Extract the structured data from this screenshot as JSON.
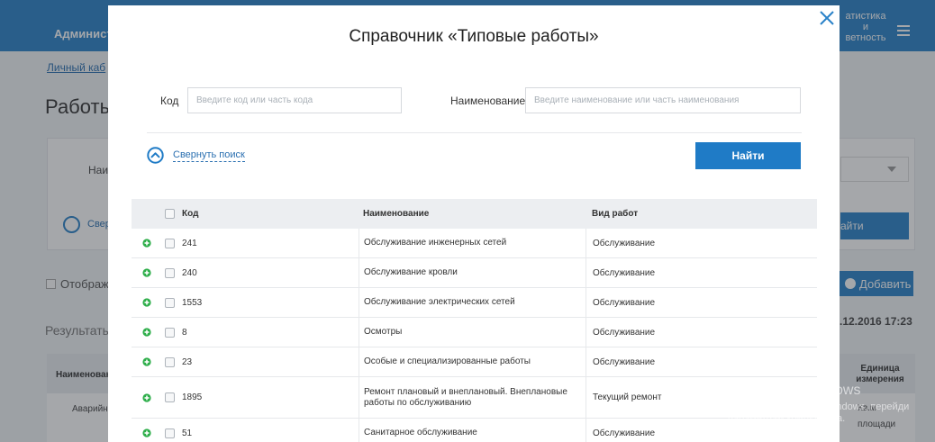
{
  "background": {
    "nav_left": "Администр",
    "nav_right_lines": [
      "атистика",
      "и",
      "ветность"
    ],
    "breadcrumb": "Личный каб",
    "page_title": "Работы",
    "filter_label": "Наим",
    "filter_collapse": "Свер",
    "filter_find": "айти",
    "show_checkbox_label": "Отобража",
    "add_button": "Добавить",
    "results_label": "Результаты",
    "date_text": ".12.2016 17:23",
    "table_header_name": "Наименован",
    "table_header_unit": "Единица измерения",
    "table_cell_name": "Аварийн",
    "table_cell_unit_lines": [
      "Кв.м",
      "площади"
    ]
  },
  "modal": {
    "title": "Справочник «Типовые работы»",
    "code_label": "Код",
    "code_placeholder": "Введите код или часть кода",
    "code_value": "",
    "name_label": "Наименование",
    "name_placeholder": "Введите наименование или часть наименования",
    "name_value": "",
    "collapse_label": "Свернуть поиск",
    "find_button": "Найти",
    "table": {
      "headers": {
        "code": "Код",
        "name": "Наименование",
        "type": "Вид работ"
      },
      "rows": [
        {
          "code": "241",
          "name": "Обслуживание инженерных сетей",
          "type": "Обслуживание"
        },
        {
          "code": "240",
          "name": "Обслуживание кровли",
          "type": "Обслуживание"
        },
        {
          "code": "1553",
          "name": "Обслуживание электрических сетей",
          "type": "Обслуживание"
        },
        {
          "code": "8",
          "name": "Осмотры",
          "type": "Обслуживание"
        },
        {
          "code": "23",
          "name": "Особые и специализированные работы",
          "type": "Обслуживание"
        },
        {
          "code": "1895",
          "name": "Ремонт плановый и внеплановый. Внеплановые работы по обслуживанию",
          "type": "Текущий ремонт"
        },
        {
          "code": "51",
          "name": "Санитарное обслуживание",
          "type": "Обслуживание"
        }
      ]
    }
  },
  "watermark": {
    "line1": "Активация Windows",
    "line2": "Чтобы активировать Windows, перейди",
    "line3": "параметрам компьютера."
  },
  "colors": {
    "brand_blue": "#2a82c9",
    "link_blue": "#2a6fb0",
    "add_green": "#2eae4a"
  },
  "icons": {
    "close": "close-icon",
    "collapse": "chevron-up-circle-icon",
    "expand_row": "plus-circle-icon",
    "menu": "hamburger-icon"
  }
}
